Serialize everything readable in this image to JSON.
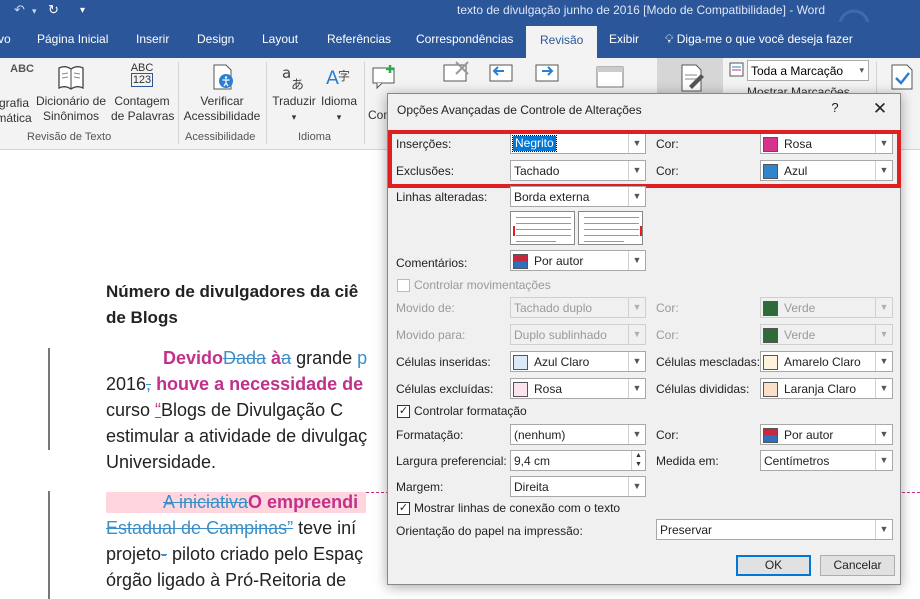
{
  "window": {
    "doc_title": "texto de divulgação junho de 2016 [Modo de Compatibilidade] - Word"
  },
  "tabs": [
    {
      "label": "vo"
    },
    {
      "label": "Página Inicial"
    },
    {
      "label": "Inserir"
    },
    {
      "label": "Design"
    },
    {
      "label": "Layout"
    },
    {
      "label": "Referências"
    },
    {
      "label": "Correspondências"
    },
    {
      "label": "Revisão"
    },
    {
      "label": "Exibir"
    }
  ],
  "tell_me": "Diga-me o que você deseja fazer",
  "ribbon": {
    "spelling_line1": "grafia",
    "spelling_line2": "mática",
    "dictionary_line1": "Dicionário de",
    "dictionary_line2": "Sinônimos",
    "word_count_line1": "Contagem",
    "word_count_line2": "de Palavras",
    "group_review": "Revisão de Texto",
    "check_access_line1": "Verificar",
    "check_access_line2": "Acessibilidade",
    "group_access": "Acessibilidade",
    "translate": "Traduzir",
    "language": "Idioma",
    "group_language": "Idioma",
    "comment_partial": "Com",
    "markup_select": "Toda a Marcação",
    "show_markup": "Mostrar Marcações",
    "accept_partial": "itar",
    "abc_icon": "ABC",
    "abc_icon_num": "123"
  },
  "document": {
    "heading_line1": "Número de divulgadores da ciê",
    "heading_line2": "de Blogs",
    "p1_ins1": "Devido",
    "p1_del1": "Dada",
    "p1_ins_a": " à",
    "p1_del_a": "a",
    "p1_plain1": " grande ",
    "p1_del_p": "p",
    "p2_plain": "2016",
    "p2_del_comma": ",",
    "p2_ins": " houve a necessidade de",
    "p3_plain": "curso ",
    "p3_ins_q": "“",
    "p3_plain2": "Blogs de Divulgação C",
    "p4": "estimular a atividade de divulgaç",
    "p5": "Universidade.",
    "p6_del": "A iniciativa",
    "p6_ins": "O empreendi",
    "p7_del": "Estadual de Campinas”",
    "p7_plain": " teve iní",
    "p8_plain": "projeto",
    "p8_del": "-",
    "p8_plain2": " piloto criado pelo Espaç",
    "p9": "órgão ligado à Pró-Reitoria de"
  },
  "dialog": {
    "title": "Opções Avançadas de Controle de Alterações",
    "help": "?",
    "close": "✕",
    "insertions_label": "Inserções:",
    "insertions_value": "Negrito",
    "insertions_color_label": "Cor:",
    "insertions_color_value": "Rosa",
    "deletions_label": "Exclusões:",
    "deletions_value": "Tachado",
    "deletions_color_label": "Cor:",
    "deletions_color_value": "Azul",
    "changed_lines_label": "Linhas alteradas:",
    "changed_lines_value": "Borda externa",
    "comments_label": "Comentários:",
    "comments_value": "Por autor",
    "track_moves_label": "Controlar movimentações",
    "track_moves_checked": false,
    "moved_from_label": "Movido de:",
    "moved_from_value": "Tachado duplo",
    "moved_from_color_label": "Cor:",
    "moved_from_color_value": "Verde",
    "moved_to_label": "Movido para:",
    "moved_to_value": "Duplo sublinhado",
    "moved_to_color_label": "Cor:",
    "moved_to_color_value": "Verde",
    "inserted_cells_label": "Células inseridas:",
    "inserted_cells_value": "Azul Claro",
    "merged_cells_label": "Células mescladas:",
    "merged_cells_value": "Amarelo Claro",
    "deleted_cells_label": "Células excluídas:",
    "deleted_cells_value": "Rosa",
    "split_cells_label": "Células divididas:",
    "split_cells_value": "Laranja Claro",
    "track_formatting_label": "Controlar formatação",
    "track_formatting_checked": true,
    "formatting_label": "Formatação:",
    "formatting_value": "(nenhum)",
    "formatting_color_label": "Cor:",
    "formatting_color_value": "Por autor",
    "preferred_width_label": "Largura preferencial:",
    "preferred_width_value": "9,4 cm",
    "measure_in_label": "Medida em:",
    "measure_in_value": "Centímetros",
    "margin_label": "Margem:",
    "margin_value": "Direita",
    "show_lines_label": "Mostrar linhas de conexão com o texto",
    "show_lines_checked": true,
    "orientation_label": "Orientação do papel na impressão:",
    "orientation_value": "Preservar",
    "ok": "OK",
    "cancel": "Cancelar"
  },
  "colors": {
    "word_blue": "#2b579a",
    "pink": "#d6338a",
    "blue": "#2f86cc",
    "green": "#2f6a3a",
    "light_blue": "#dde9f7",
    "light_pink": "#fbe3ef",
    "light_yellow": "#fdf2dc",
    "light_orange": "#fbe0c9",
    "author_top": "#c8283c",
    "author_bottom": "#2f6fbf",
    "highlight": "#ffd6de",
    "red_box": "#e02020"
  }
}
